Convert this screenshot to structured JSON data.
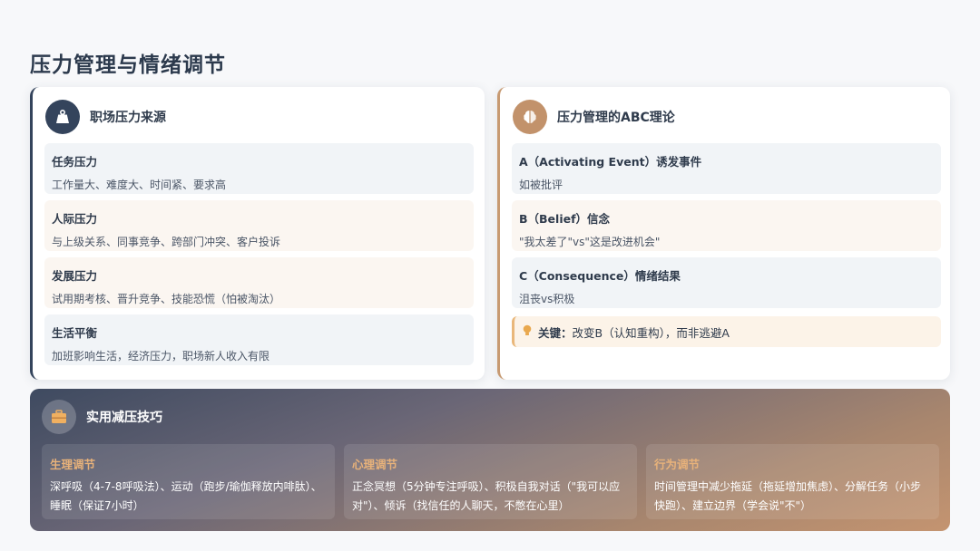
{
  "page": {
    "title": "压力管理与情绪调节"
  },
  "left_card": {
    "title": "职场压力来源",
    "icon": "weight-icon",
    "items": [
      {
        "title": "任务压力",
        "desc": "工作量大、难度大、时间紧、要求高"
      },
      {
        "title": "人际压力",
        "desc": "与上级关系、同事竞争、跨部门冲突、客户投诉"
      },
      {
        "title": "发展压力",
        "desc": "试用期考核、晋升竞争、技能恐慌（怕被淘汰）"
      },
      {
        "title": "生活平衡",
        "desc": "加班影响生活，经济压力，职场新人收入有限"
      }
    ]
  },
  "right_card": {
    "title": "压力管理的ABC理论",
    "icon": "brain-icon",
    "items": [
      {
        "title": "A（Activating Event）诱发事件",
        "desc": "如被批评"
      },
      {
        "title": "B（Belief）信念",
        "desc": "\"我太差了\"vs\"这是改进机会\""
      },
      {
        "title": "C（Consequence）情绪结果",
        "desc": "沮丧vs积极"
      }
    ],
    "key": {
      "label": "关键：",
      "text": "改变B（认知重构），而非逃避A"
    }
  },
  "bottom": {
    "title": "实用减压技巧",
    "icon": "toolbox-icon",
    "techniques": [
      {
        "title": "生理调节",
        "desc": "深呼吸（4-7-8呼吸法）、运动（跑步/瑜伽释放内啡肽）、睡眠（保证7小时）"
      },
      {
        "title": "心理调节",
        "desc": "正念冥想（5分钟专注呼吸）、积极自我对话（\"我可以应对\"）、倾诉（找信任的人聊天，不憋在心里）"
      },
      {
        "title": "行为调节",
        "desc": "时间管理中减少拖延（拖延增加焦虑）、分解任务（小步快跑）、建立边界（学会说\"不\"）"
      }
    ]
  },
  "colors": {
    "dark": "#34445c",
    "tan": "#c2926b",
    "accent": "#e8b27a"
  }
}
